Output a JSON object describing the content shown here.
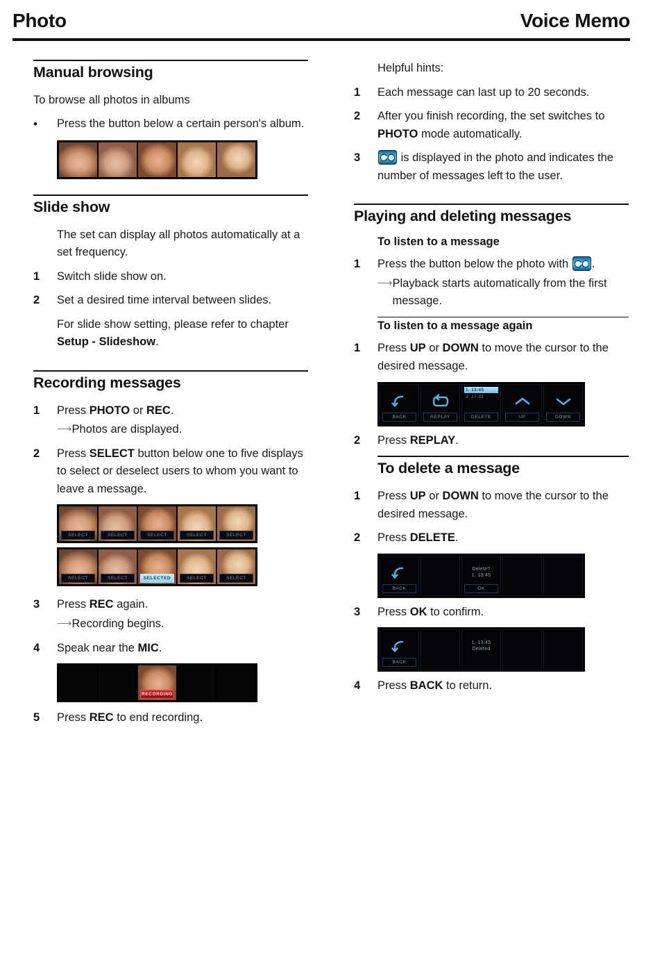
{
  "header": {
    "left_title": "Photo",
    "right_title": "Voice Memo"
  },
  "left_column": {
    "manual_browsing": {
      "heading": "Manual browsing",
      "intro": "To browse all photos in albums",
      "bullet_marker": "•",
      "bullet_text": "Press the button below a certain person's album.",
      "photo_strip_labels": [
        "",
        "",
        "",
        "",
        ""
      ]
    },
    "slide_show": {
      "heading": "Slide show",
      "intro": "The set can display all photos automatically at a set frequency.",
      "steps": [
        {
          "num": "1",
          "text": "Switch slide show on."
        },
        {
          "num": "2",
          "text": "Set a desired time interval between slides."
        }
      ],
      "note_prefix": "For slide show setting, please refer to chapter ",
      "note_bold": "Setup - Slideshow",
      "note_suffix": "."
    },
    "recording_messages": {
      "heading": "Recording messages",
      "step1": {
        "num": "1",
        "pre": "Press ",
        "b1": "PHOTO",
        "mid": " or ",
        "b2": "REC",
        "post": "."
      },
      "step1_arrow": "Photos are displayed.",
      "step2": {
        "num": "2",
        "pre": "Press ",
        "b1": "SELECT",
        "post": " button below one to five displays to select or deselect users to whom you want to leave a message."
      },
      "strip1_labels": [
        "SELECT",
        "SELECT",
        "SELECT",
        "SELECT",
        "SELECT"
      ],
      "strip2_labels": [
        "SELECT",
        "SELECT",
        "SELECTED",
        "SELECT",
        "SELECT"
      ],
      "strip2_selected_index": 2,
      "step3": {
        "num": "3",
        "pre": "Press ",
        "b1": "REC",
        "post": " again."
      },
      "step3_arrow": "Recording begins.",
      "step4": {
        "num": "4",
        "pre": "Speak near the ",
        "b1": "MIC",
        "post": "."
      },
      "recording_label": "RECORDING",
      "step5": {
        "num": "5",
        "pre": "Press ",
        "b1": "REC",
        "post": " to end recording."
      }
    }
  },
  "right_column": {
    "helpful_hints": {
      "intro": "Helpful hints:",
      "hint1": {
        "num": "1",
        "text": "Each message can last up to 20 seconds."
      },
      "hint2": {
        "num": "2",
        "pre": "After you finish recording, the set switches to ",
        "b1": "PHOTO",
        "post": " mode automatically."
      },
      "hint3": {
        "num": "3",
        "icon": "voice-memo-icon",
        "text": " is displayed in the photo and indicates the number of messages left to the user."
      }
    },
    "playing_deleting": {
      "heading": "Playing and deleting messages",
      "listen": {
        "subheading": "To listen to a message",
        "step1": {
          "num": "1",
          "pre": "Press the button below the photo with ",
          "icon": "voice-memo-icon",
          "post": "."
        },
        "step1_arrow": "Playback starts automatically from the first message."
      },
      "listen_again": {
        "subheading": "To listen to a message again",
        "step1": {
          "num": "1",
          "pre": "Press ",
          "b1": "UP",
          "mid": " or ",
          "b2": "DOWN",
          "post": " to move the cursor to the desired message."
        },
        "step2": {
          "num": "2",
          "pre": "Press ",
          "b1": "REPLAY",
          "post": "."
        }
      },
      "player_screen": {
        "buttons": [
          "BACK",
          "REPLAY",
          "DELETE",
          "UP",
          "DOWN"
        ],
        "messages": [
          "1. 13:45",
          "2. 17:33"
        ],
        "selected_message_index": 0,
        "icons": [
          "back-arrow-icon",
          "replay-loop-icon",
          "",
          "chevron-up-icon",
          "chevron-down-icon"
        ]
      },
      "delete": {
        "subheading": "To delete a message",
        "step1": {
          "num": "1",
          "pre": "Press ",
          "b1": "UP",
          "mid": " or ",
          "b2": "DOWN",
          "post": " to move the cursor to the desired message."
        },
        "step2": {
          "num": "2",
          "pre": "Press ",
          "b1": "DELETE",
          "post": "."
        },
        "confirm_screen": {
          "back_label": "BACK",
          "prompt": "Delete?",
          "message": "1. 13:45",
          "ok_label": "OK"
        },
        "step3": {
          "num": "3",
          "pre": "Press ",
          "b1": "OK",
          "post": " to confirm."
        },
        "result_screen": {
          "back_label": "BACK",
          "message": "1. 13:45",
          "status": "Deleted"
        },
        "step4": {
          "num": "4",
          "pre": "Press ",
          "b1": "BACK",
          "post": " to return."
        }
      }
    }
  },
  "colors": {
    "rule": "#111111",
    "text": "#1a1a1a",
    "screen_bg": "#000000",
    "screen_accent": "#55b6e0",
    "select_highlight": "#9fdcf5",
    "recording_red": "#c0202a"
  }
}
